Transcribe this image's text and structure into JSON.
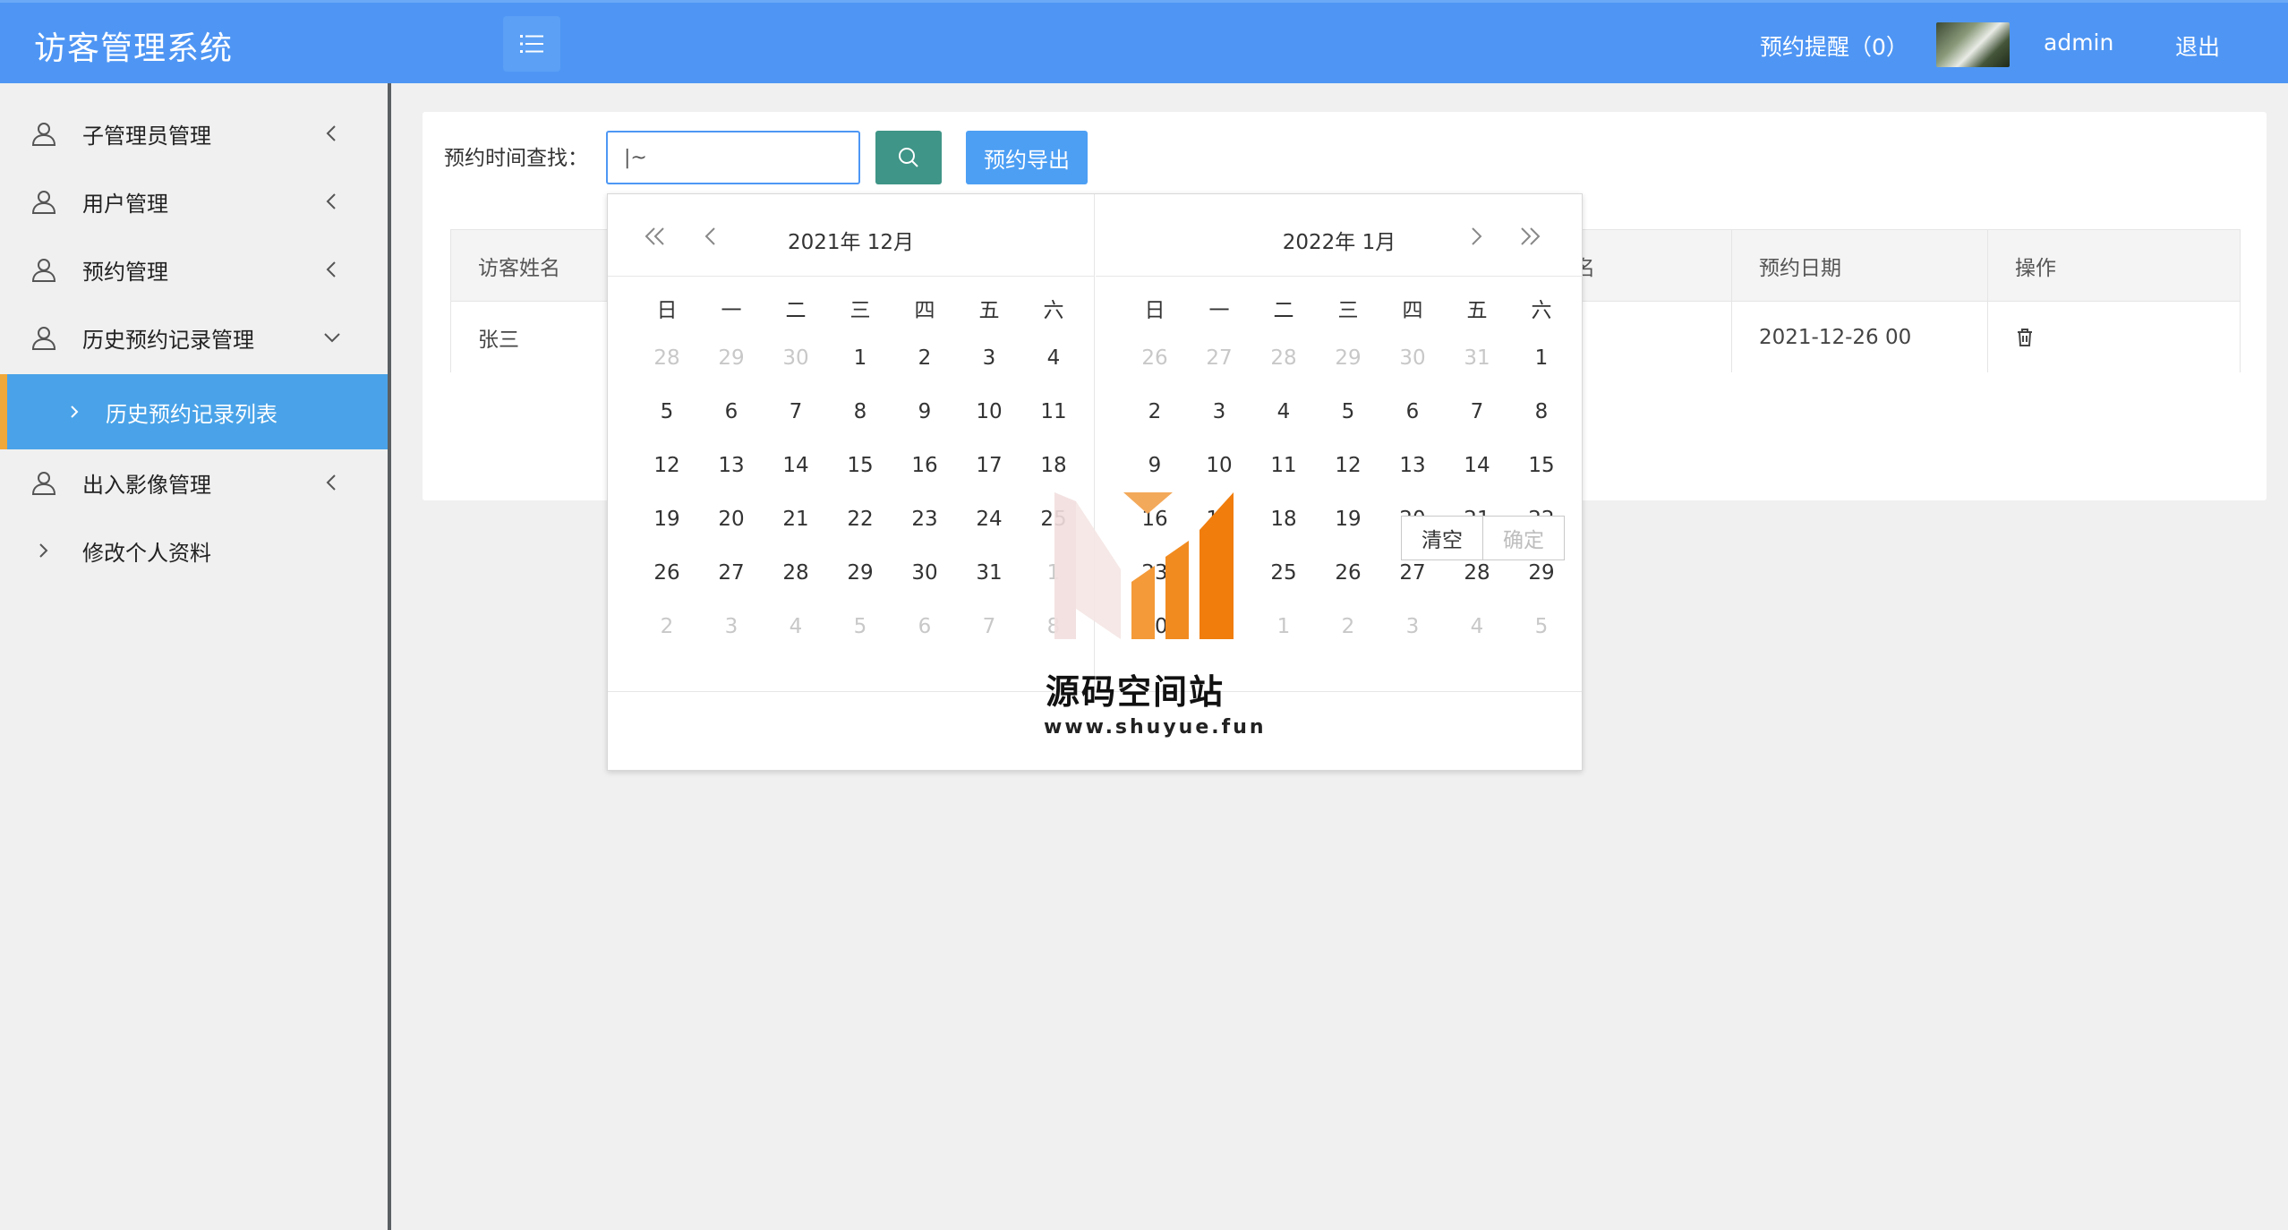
{
  "app": {
    "title": "访客管理系统"
  },
  "header": {
    "reminder": "预约提醒（0）",
    "username": "admin",
    "logout": "退出"
  },
  "sidebar": {
    "items": [
      {
        "label": "子管理员管理"
      },
      {
        "label": "用户管理"
      },
      {
        "label": "预约管理"
      },
      {
        "label": "历史预约记录管理"
      },
      {
        "label": "历史预约记录列表"
      },
      {
        "label": "出入影像管理"
      },
      {
        "label": "修改个人资料"
      }
    ]
  },
  "search": {
    "label": "预约时间查找：",
    "value": "|~",
    "export_label": "预约导出"
  },
  "table": {
    "columns": [
      "访客姓名",
      "名",
      "预约日期",
      "操作"
    ],
    "rows": [
      {
        "name": "张三",
        "date": "2021-12-26 00"
      }
    ]
  },
  "picker": {
    "weekdays": [
      "日",
      "一",
      "二",
      "三",
      "四",
      "五",
      "六"
    ],
    "left": {
      "title": "2021年 12月",
      "days": [
        "28",
        "29",
        "30",
        "1",
        "2",
        "3",
        "4",
        "5",
        "6",
        "7",
        "8",
        "9",
        "10",
        "11",
        "12",
        "13",
        "14",
        "15",
        "16",
        "17",
        "18",
        "19",
        "20",
        "21",
        "22",
        "23",
        "24",
        "25",
        "26",
        "27",
        "28",
        "29",
        "30",
        "31",
        "1",
        "2",
        "3",
        "4",
        "5",
        "6",
        "7",
        "8"
      ],
      "other_leading": 3,
      "other_trailing_from": 34
    },
    "right": {
      "title": "2022年 1月",
      "days": [
        "26",
        "27",
        "28",
        "29",
        "30",
        "31",
        "1",
        "2",
        "3",
        "4",
        "5",
        "6",
        "7",
        "8",
        "9",
        "10",
        "11",
        "12",
        "13",
        "14",
        "15",
        "16",
        "17",
        "18",
        "19",
        "20",
        "21",
        "22",
        "23",
        "24",
        "25",
        "26",
        "27",
        "28",
        "29",
        "30",
        "31",
        "1",
        "2",
        "3",
        "4",
        "5"
      ],
      "other_leading": 6,
      "other_trailing_from": 37
    },
    "clear": "清空",
    "confirm": "确定"
  },
  "watermark": {
    "title": "源码空间站",
    "url": "www.shuyue.fun"
  },
  "colors": {
    "header": "#4f96f4",
    "active_nav": "#4aa3e8",
    "search_btn": "#3f9587",
    "export_btn": "#4d9ff4"
  }
}
